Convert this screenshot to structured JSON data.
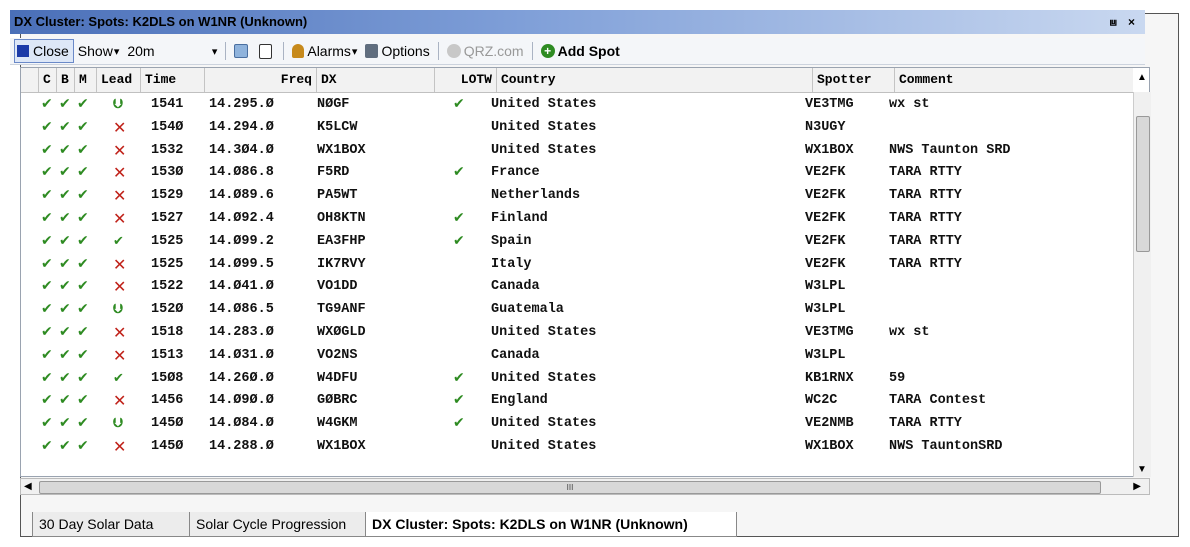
{
  "window": {
    "title": "DX Cluster: Spots: K2DLS on W1NR (Unknown)",
    "controls": "⩏ ×"
  },
  "toolbar": {
    "close_label": "Close",
    "show_label": "Show",
    "band_value": "20m",
    "alarms_label": "Alarms",
    "options_label": "Options",
    "qrz_label": "QRZ.com",
    "add_spot_label": "Add Spot",
    "dropdown_glyph": "▾"
  },
  "columns": [
    "C",
    "B",
    "M",
    "Lead",
    "Time",
    "Freq",
    "DX",
    "LOTW",
    "Country",
    "Spotter",
    "Comment"
  ],
  "rows": [
    {
      "c": "✔",
      "b": "✔",
      "m": "✔",
      "lead": "⮋",
      "lead_type": "arrow",
      "time": "1541",
      "freq": "14.295.Ø",
      "dx": "NØGF",
      "lotw": "✔",
      "country": "United States",
      "spotter": "VE3TMG",
      "comment": "wx st"
    },
    {
      "c": "✔",
      "b": "✔",
      "m": "✔",
      "lead": "✕",
      "lead_type": "x",
      "time": "154Ø",
      "freq": "14.294.Ø",
      "dx": "K5LCW",
      "lotw": "",
      "country": "United States",
      "spotter": "N3UGY",
      "comment": ""
    },
    {
      "c": "✔",
      "b": "✔",
      "m": "✔",
      "lead": "✕",
      "lead_type": "x",
      "time": "1532",
      "freq": "14.3Ø4.Ø",
      "dx": "WX1BOX",
      "lotw": "",
      "country": "United States",
      "spotter": "WX1BOX",
      "comment": "NWS Taunton SRD"
    },
    {
      "c": "✔",
      "b": "✔",
      "m": "✔",
      "lead": "✕",
      "lead_type": "x",
      "time": "153Ø",
      "freq": "14.Ø86.8",
      "dx": "F5RD",
      "lotw": "✔",
      "country": "France",
      "spotter": "VE2FK",
      "comment": "TARA RTTY"
    },
    {
      "c": "✔",
      "b": "✔",
      "m": "✔",
      "lead": "✕",
      "lead_type": "x",
      "time": "1529",
      "freq": "14.Ø89.6",
      "dx": "PA5WT",
      "lotw": "",
      "country": "Netherlands",
      "spotter": "VE2FK",
      "comment": "TARA RTTY"
    },
    {
      "c": "✔",
      "b": "✔",
      "m": "✔",
      "lead": "✕",
      "lead_type": "x",
      "time": "1527",
      "freq": "14.Ø92.4",
      "dx": "OH8KTN",
      "lotw": "✔",
      "country": "Finland",
      "spotter": "VE2FK",
      "comment": "TARA RTTY"
    },
    {
      "c": "✔",
      "b": "✔",
      "m": "✔",
      "lead": "✔",
      "lead_type": "check",
      "time": "1525",
      "freq": "14.Ø99.2",
      "dx": "EA3FHP",
      "lotw": "✔",
      "country": "Spain",
      "spotter": "VE2FK",
      "comment": "TARA RTTY"
    },
    {
      "c": "✔",
      "b": "✔",
      "m": "✔",
      "lead": "✕",
      "lead_type": "x",
      "time": "1525",
      "freq": "14.Ø99.5",
      "dx": "IK7RVY",
      "lotw": "",
      "country": "Italy",
      "spotter": "VE2FK",
      "comment": "TARA RTTY"
    },
    {
      "c": "✔",
      "b": "✔",
      "m": "✔",
      "lead": "✕",
      "lead_type": "x",
      "time": "1522",
      "freq": "14.Ø41.Ø",
      "dx": "VO1DD",
      "lotw": "",
      "country": "Canada",
      "spotter": "W3LPL",
      "comment": ""
    },
    {
      "c": "✔",
      "b": "✔",
      "m": "✔",
      "lead": "⮋",
      "lead_type": "arrow",
      "time": "152Ø",
      "freq": "14.Ø86.5",
      "dx": "TG9ANF",
      "lotw": "",
      "country": "Guatemala",
      "spotter": "W3LPL",
      "comment": ""
    },
    {
      "c": "✔",
      "b": "✔",
      "m": "✔",
      "lead": "✕",
      "lead_type": "x",
      "time": "1518",
      "freq": "14.283.Ø",
      "dx": "WXØGLD",
      "lotw": "",
      "country": "United States",
      "spotter": "VE3TMG",
      "comment": "wx st"
    },
    {
      "c": "✔",
      "b": "✔",
      "m": "✔",
      "lead": "✕",
      "lead_type": "x",
      "time": "1513",
      "freq": "14.Ø31.Ø",
      "dx": "VO2NS",
      "lotw": "",
      "country": "Canada",
      "spotter": "W3LPL",
      "comment": ""
    },
    {
      "c": "✔",
      "b": "✔",
      "m": "✔",
      "lead": "✔",
      "lead_type": "check",
      "time": "15Ø8",
      "freq": "14.26Ø.Ø",
      "dx": "W4DFU",
      "lotw": "✔",
      "country": "United States",
      "spotter": "KB1RNX",
      "comment": "59"
    },
    {
      "c": "✔",
      "b": "✔",
      "m": "✔",
      "lead": "✕",
      "lead_type": "x",
      "time": "1456",
      "freq": "14.Ø9Ø.Ø",
      "dx": "GØBRC",
      "lotw": "✔",
      "country": "England",
      "spotter": "WC2C",
      "comment": "TARA Contest"
    },
    {
      "c": "✔",
      "b": "✔",
      "m": "✔",
      "lead": "⮋",
      "lead_type": "arrow",
      "time": "145Ø",
      "freq": "14.Ø84.Ø",
      "dx": "W4GKM",
      "lotw": "✔",
      "country": "United States",
      "spotter": "VE2NMB",
      "comment": "TARA RTTY"
    },
    {
      "c": "✔",
      "b": "✔",
      "m": "✔",
      "lead": "✕",
      "lead_type": "x",
      "time": "145Ø",
      "freq": "14.288.Ø",
      "dx": "WX1BOX",
      "lotw": "",
      "country": "United States",
      "spotter": "WX1BOX",
      "comment": "NWS TauntonSRD"
    }
  ],
  "hscroll_grip": "III",
  "tabs": [
    "30 Day Solar Data",
    "Solar Cycle Progression",
    "DX Cluster: Spots: K2DLS on W1NR (Unknown)"
  ],
  "colors": {
    "check": "#2e8b22",
    "x": "#c0221a",
    "title_start": "#4a6fb8"
  }
}
